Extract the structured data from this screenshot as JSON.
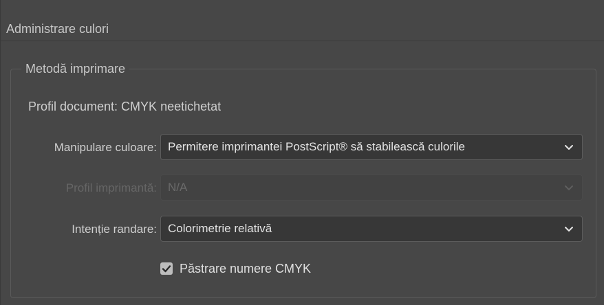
{
  "section": {
    "title": "Administrare culori"
  },
  "group": {
    "title": "Metodă imprimare",
    "profile_document": "Profil document: CMYK neetichetat"
  },
  "fields": {
    "color_handling": {
      "label": "Manipulare culoare:",
      "value": "Permitere imprimantei PostScript® să stabilească culorile",
      "enabled": true
    },
    "printer_profile": {
      "label": "Profil imprimantă:",
      "value": "N/A",
      "enabled": false
    },
    "rendering_intent": {
      "label": "Intenție randare:",
      "value": "Colorimetrie relativă",
      "enabled": true
    }
  },
  "preserve_cmyk": {
    "label": "Păstrare numere CMYK",
    "checked": true
  },
  "colors": {
    "panel_bg": "#474747",
    "field_bg": "#373737",
    "text": "#cfcfcf",
    "disabled_text": "#666666"
  },
  "icons": {
    "dropdown": "chevron-down-icon",
    "checkbox": "checkmark-icon"
  }
}
